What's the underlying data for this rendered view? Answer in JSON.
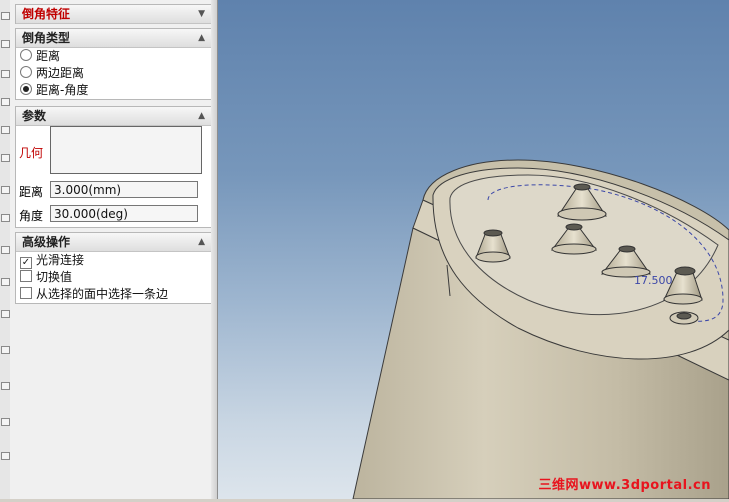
{
  "panel": {
    "title": "倒角特征",
    "chamfer_type": {
      "header": "倒角类型",
      "options": [
        "距离",
        "两边距离",
        "距离-角度"
      ],
      "selected_index": 2
    },
    "params": {
      "header": "参数",
      "geometry_label": "几何",
      "distance_label": "距离",
      "distance_value": "3.000(mm)",
      "angle_label": "角度",
      "angle_value": "30.000(deg)"
    },
    "advanced": {
      "header": "高级操作",
      "options": [
        {
          "label": "光滑连接",
          "checked": true
        },
        {
          "label": "切换值",
          "checked": false
        },
        {
          "label": "从选择的面中选择一条边",
          "checked": false
        }
      ]
    }
  },
  "viewport": {
    "dimension_label": "17.500",
    "watermark": "三维网www.3dportal.cn"
  },
  "colors": {
    "title_red": "#c00000",
    "dimension_blue": "#3b47a8",
    "watermark_red": "#e8141e",
    "model_body": "#c9c2ad"
  },
  "icons": [
    "collapse-chevron-icon",
    "radio-icon",
    "checkbox-icon"
  ]
}
